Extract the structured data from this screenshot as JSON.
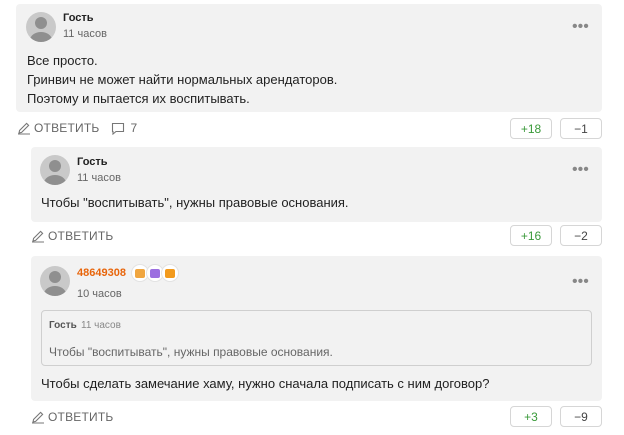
{
  "comments": [
    {
      "author": "Гость",
      "time": "11 часов",
      "lines": [
        "Все просто.",
        "Гринвич не может найти нормальных арендаторов.",
        "Поэтому и пытается их воспитывать."
      ],
      "reply_label": "ОТВЕТИТЬ",
      "replies_count": "7",
      "votes_up": "+18",
      "votes_down": "−1"
    },
    {
      "author": "Гость",
      "time": "11 часов",
      "text": "Чтобы \"воспитывать\", нужны правовые основания.",
      "reply_label": "ОТВЕТИТЬ",
      "votes_up": "+16",
      "votes_down": "−2"
    },
    {
      "author": "48649308",
      "time": "10 часов",
      "badges": [
        {
          "icon": "award-badge-icon",
          "color": "#f0a640"
        },
        {
          "icon": "award-badge-icon",
          "color": "#9c6fe0"
        },
        {
          "icon": "award-badge-icon",
          "color": "#f29a1d"
        }
      ],
      "quote": {
        "author": "Гость",
        "time": "11 часов",
        "text": "Чтобы \"воспитывать\", нужны правовые основания."
      },
      "text": "Чтобы сделать замечание хаму, нужно сначала подписать с ним договор?",
      "reply_label": "ОТВЕТИТЬ",
      "votes_up": "+3",
      "votes_down": "−9"
    }
  ],
  "more_glyph": "•••"
}
